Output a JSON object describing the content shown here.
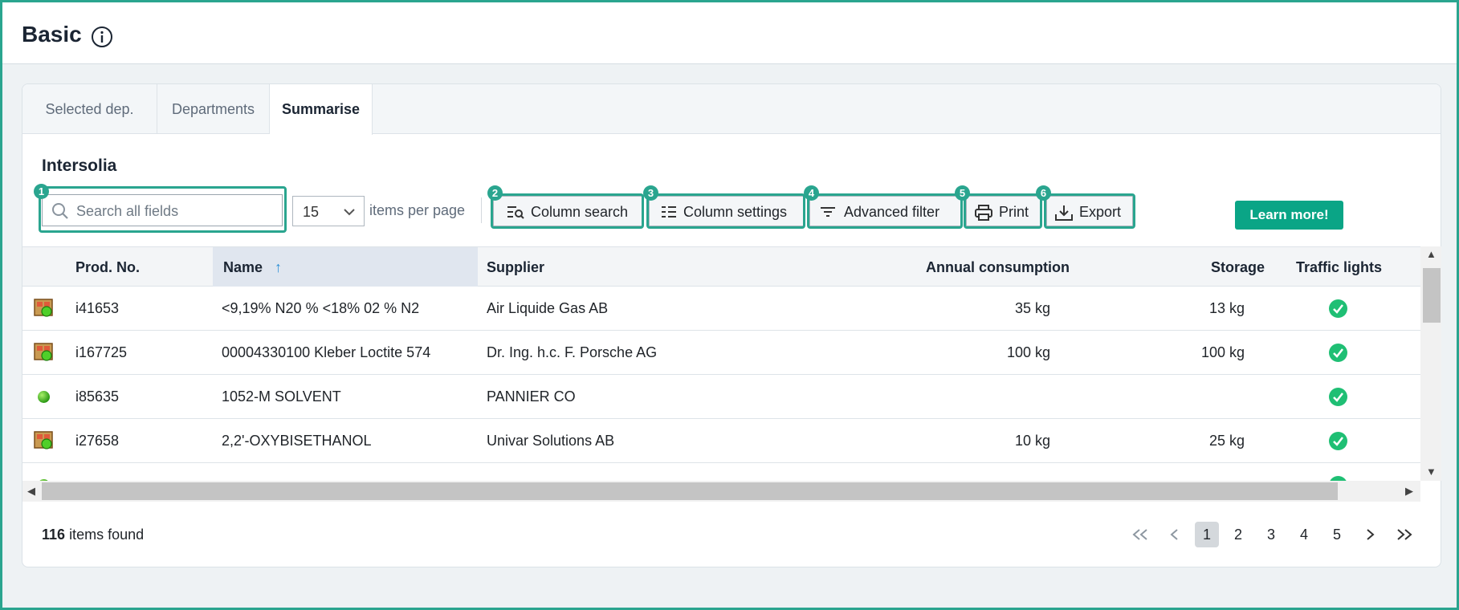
{
  "header": {
    "title": "Basic"
  },
  "tabs": [
    {
      "label": "Selected dep."
    },
    {
      "label": "Departments"
    },
    {
      "label": "Summarise"
    }
  ],
  "section": {
    "title": "Intersolia"
  },
  "toolbar": {
    "search_placeholder": "Search all fields",
    "per_page_value": "15",
    "per_page_label": "items per page",
    "column_search": "Column search",
    "column_settings": "Column settings",
    "advanced_filter": "Advanced filter",
    "print": "Print",
    "export": "Export",
    "learn_more": "Learn more!",
    "badges": [
      "1",
      "2",
      "3",
      "4",
      "5",
      "6"
    ]
  },
  "table": {
    "columns": [
      "Prod. No.",
      "Name",
      "Supplier",
      "Annual consumption",
      "Storage",
      "Traffic lights"
    ],
    "sort_indicator": "↑",
    "rows": [
      {
        "icon": "package-icon",
        "prod_no": "i41653",
        "name": "<9,19% N20 % <18% 02 % N2",
        "supplier": "Air Liquide Gas AB",
        "annual": "35 kg",
        "storage": "13 kg",
        "traffic": "green"
      },
      {
        "icon": "package-icon",
        "prod_no": "i167725",
        "name": "00004330100 Kleber Loctite 574",
        "supplier": "Dr. Ing. h.c. F. Porsche AG",
        "annual": "100 kg",
        "storage": "100 kg",
        "traffic": "green"
      },
      {
        "icon": "green-dot-icon",
        "prod_no": "i85635",
        "name": "1052-M SOLVENT",
        "supplier": "PANNIER CO",
        "annual": "",
        "storage": "",
        "traffic": "green"
      },
      {
        "icon": "package-icon",
        "prod_no": "i27658",
        "name": "2,2'-OXYBISETHANOL",
        "supplier": "Univar Solutions AB",
        "annual": "10 kg",
        "storage": "25 kg",
        "traffic": "green"
      }
    ]
  },
  "footer": {
    "count": "116",
    "count_label": "items found",
    "pages": [
      "1",
      "2",
      "3",
      "4",
      "5"
    ],
    "current_page": "1"
  },
  "colors": {
    "accent": "#2aa58f",
    "learn_button": "#0aa586",
    "traffic_green": "#1fbf74"
  }
}
